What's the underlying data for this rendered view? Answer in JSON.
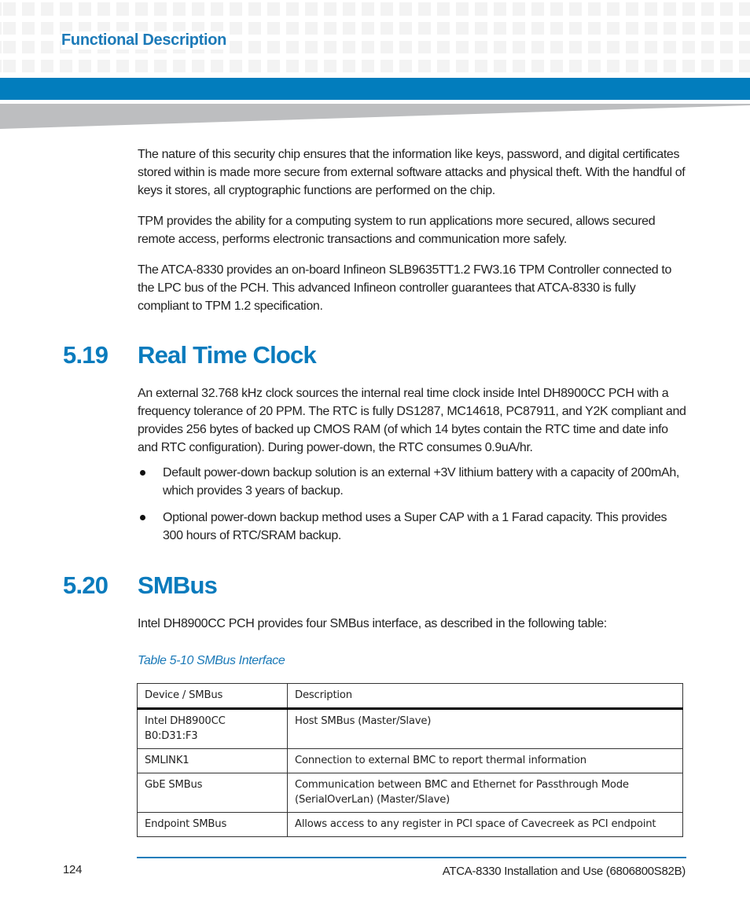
{
  "header": {
    "title": "Functional Description",
    "colors": {
      "accent": "#027dbd",
      "heading": "#0a7bbd",
      "wedge": "#bdbec0"
    }
  },
  "intro_paragraphs": [
    "The nature of this security chip ensures that the information like keys, password, and digital certificates stored within is made more secure from external software attacks and physical theft. With the handful of keys it stores, all cryptographic functions are performed on the chip.",
    "TPM provides the ability for a computing system to run applications more secured, allows secured remote access, performs electronic transactions and communication more safely.",
    "The ATCA-8330 provides an on-board Infineon SLB9635TT1.2 FW3.16 TPM Controller connected to the LPC bus of the PCH. This advanced Infineon controller guarantees that ATCA-8330 is fully compliant to TPM 1.2 specification."
  ],
  "section_519": {
    "number": "5.19",
    "title": "Real Time Clock",
    "paragraph": "An external 32.768 kHz clock sources the internal real time clock inside Intel DH8900CC PCH with a frequency tolerance of 20 PPM. The RTC is fully DS1287, MC14618, PC87911, and Y2K compliant and provides 256 bytes of backed up CMOS RAM (of which 14 bytes contain the RTC time and date info and RTC configuration). During power-down, the RTC consumes 0.9uA/hr.",
    "bullets": [
      "Default power-down backup solution is an external +3V lithium battery with a capacity of 200mAh, which provides 3 years of backup.",
      "Optional power-down backup method uses a Super CAP with a 1 Farad capacity. This provides 300 hours of RTC/SRAM backup."
    ]
  },
  "section_520": {
    "number": "5.20",
    "title": "SMBus",
    "paragraph": "Intel DH8900CC PCH provides four SMBus interface, as described in the following table:",
    "table": {
      "caption": "Table 5-10 SMBus Interface",
      "headers": [
        "Device / SMBus",
        "Description"
      ],
      "rows": [
        {
          "device_line1": "Intel DH8900CC",
          "device_line2": "B0:D31:F3",
          "description": "Host SMBus (Master/Slave)"
        },
        {
          "device_line1": "SMLINK1",
          "device_line2": "",
          "description": "Connection to external BMC to report thermal information"
        },
        {
          "device_line1": "GbE SMBus",
          "device_line2": "",
          "description": "Communication between BMC and Ethernet for Passthrough Mode (SerialOverLan) (Master/Slave)"
        },
        {
          "device_line1": "Endpoint SMBus",
          "device_line2": "",
          "description": "Allows access to any register in PCI space of Cavecreek as PCI endpoint"
        }
      ]
    }
  },
  "footer": {
    "page_number": "124",
    "document_title": "ATCA-8330 Installation and Use (6806800S82B)"
  }
}
